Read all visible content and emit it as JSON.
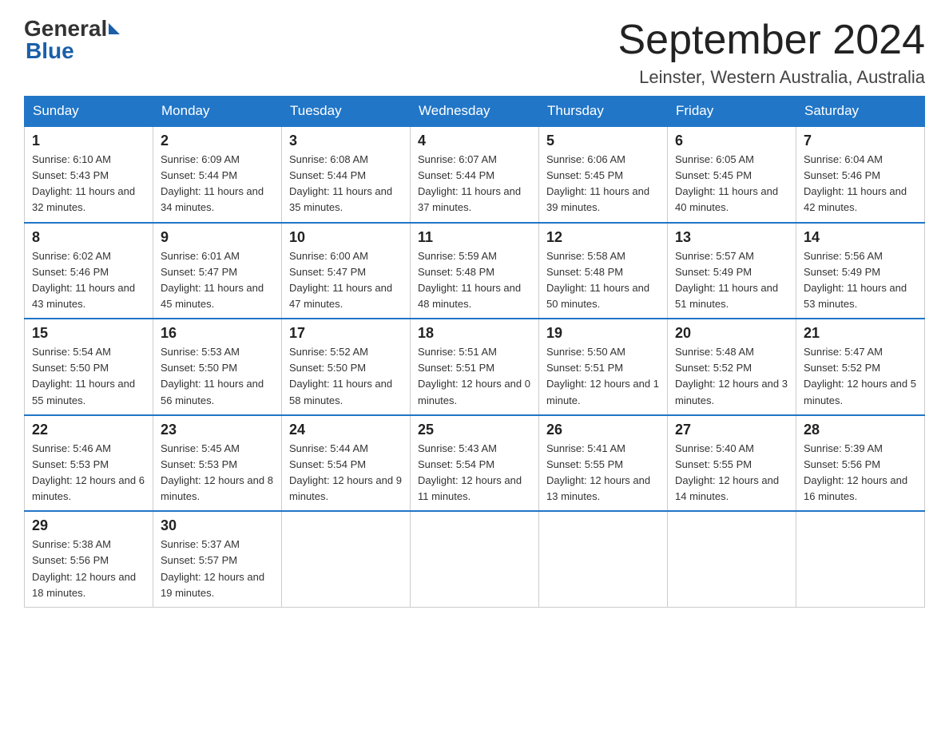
{
  "header": {
    "logo": {
      "general": "General",
      "blue": "Blue"
    },
    "title": "September 2024",
    "location": "Leinster, Western Australia, Australia"
  },
  "days_of_week": [
    "Sunday",
    "Monday",
    "Tuesday",
    "Wednesday",
    "Thursday",
    "Friday",
    "Saturday"
  ],
  "weeks": [
    [
      {
        "day": "1",
        "sunrise": "6:10 AM",
        "sunset": "5:43 PM",
        "daylight": "11 hours and 32 minutes."
      },
      {
        "day": "2",
        "sunrise": "6:09 AM",
        "sunset": "5:44 PM",
        "daylight": "11 hours and 34 minutes."
      },
      {
        "day": "3",
        "sunrise": "6:08 AM",
        "sunset": "5:44 PM",
        "daylight": "11 hours and 35 minutes."
      },
      {
        "day": "4",
        "sunrise": "6:07 AM",
        "sunset": "5:44 PM",
        "daylight": "11 hours and 37 minutes."
      },
      {
        "day": "5",
        "sunrise": "6:06 AM",
        "sunset": "5:45 PM",
        "daylight": "11 hours and 39 minutes."
      },
      {
        "day": "6",
        "sunrise": "6:05 AM",
        "sunset": "5:45 PM",
        "daylight": "11 hours and 40 minutes."
      },
      {
        "day": "7",
        "sunrise": "6:04 AM",
        "sunset": "5:46 PM",
        "daylight": "11 hours and 42 minutes."
      }
    ],
    [
      {
        "day": "8",
        "sunrise": "6:02 AM",
        "sunset": "5:46 PM",
        "daylight": "11 hours and 43 minutes."
      },
      {
        "day": "9",
        "sunrise": "6:01 AM",
        "sunset": "5:47 PM",
        "daylight": "11 hours and 45 minutes."
      },
      {
        "day": "10",
        "sunrise": "6:00 AM",
        "sunset": "5:47 PM",
        "daylight": "11 hours and 47 minutes."
      },
      {
        "day": "11",
        "sunrise": "5:59 AM",
        "sunset": "5:48 PM",
        "daylight": "11 hours and 48 minutes."
      },
      {
        "day": "12",
        "sunrise": "5:58 AM",
        "sunset": "5:48 PM",
        "daylight": "11 hours and 50 minutes."
      },
      {
        "day": "13",
        "sunrise": "5:57 AM",
        "sunset": "5:49 PM",
        "daylight": "11 hours and 51 minutes."
      },
      {
        "day": "14",
        "sunrise": "5:56 AM",
        "sunset": "5:49 PM",
        "daylight": "11 hours and 53 minutes."
      }
    ],
    [
      {
        "day": "15",
        "sunrise": "5:54 AM",
        "sunset": "5:50 PM",
        "daylight": "11 hours and 55 minutes."
      },
      {
        "day": "16",
        "sunrise": "5:53 AM",
        "sunset": "5:50 PM",
        "daylight": "11 hours and 56 minutes."
      },
      {
        "day": "17",
        "sunrise": "5:52 AM",
        "sunset": "5:50 PM",
        "daylight": "11 hours and 58 minutes."
      },
      {
        "day": "18",
        "sunrise": "5:51 AM",
        "sunset": "5:51 PM",
        "daylight": "12 hours and 0 minutes."
      },
      {
        "day": "19",
        "sunrise": "5:50 AM",
        "sunset": "5:51 PM",
        "daylight": "12 hours and 1 minute."
      },
      {
        "day": "20",
        "sunrise": "5:48 AM",
        "sunset": "5:52 PM",
        "daylight": "12 hours and 3 minutes."
      },
      {
        "day": "21",
        "sunrise": "5:47 AM",
        "sunset": "5:52 PM",
        "daylight": "12 hours and 5 minutes."
      }
    ],
    [
      {
        "day": "22",
        "sunrise": "5:46 AM",
        "sunset": "5:53 PM",
        "daylight": "12 hours and 6 minutes."
      },
      {
        "day": "23",
        "sunrise": "5:45 AM",
        "sunset": "5:53 PM",
        "daylight": "12 hours and 8 minutes."
      },
      {
        "day": "24",
        "sunrise": "5:44 AM",
        "sunset": "5:54 PM",
        "daylight": "12 hours and 9 minutes."
      },
      {
        "day": "25",
        "sunrise": "5:43 AM",
        "sunset": "5:54 PM",
        "daylight": "12 hours and 11 minutes."
      },
      {
        "day": "26",
        "sunrise": "5:41 AM",
        "sunset": "5:55 PM",
        "daylight": "12 hours and 13 minutes."
      },
      {
        "day": "27",
        "sunrise": "5:40 AM",
        "sunset": "5:55 PM",
        "daylight": "12 hours and 14 minutes."
      },
      {
        "day": "28",
        "sunrise": "5:39 AM",
        "sunset": "5:56 PM",
        "daylight": "12 hours and 16 minutes."
      }
    ],
    [
      {
        "day": "29",
        "sunrise": "5:38 AM",
        "sunset": "5:56 PM",
        "daylight": "12 hours and 18 minutes."
      },
      {
        "day": "30",
        "sunrise": "5:37 AM",
        "sunset": "5:57 PM",
        "daylight": "12 hours and 19 minutes."
      },
      null,
      null,
      null,
      null,
      null
    ]
  ]
}
